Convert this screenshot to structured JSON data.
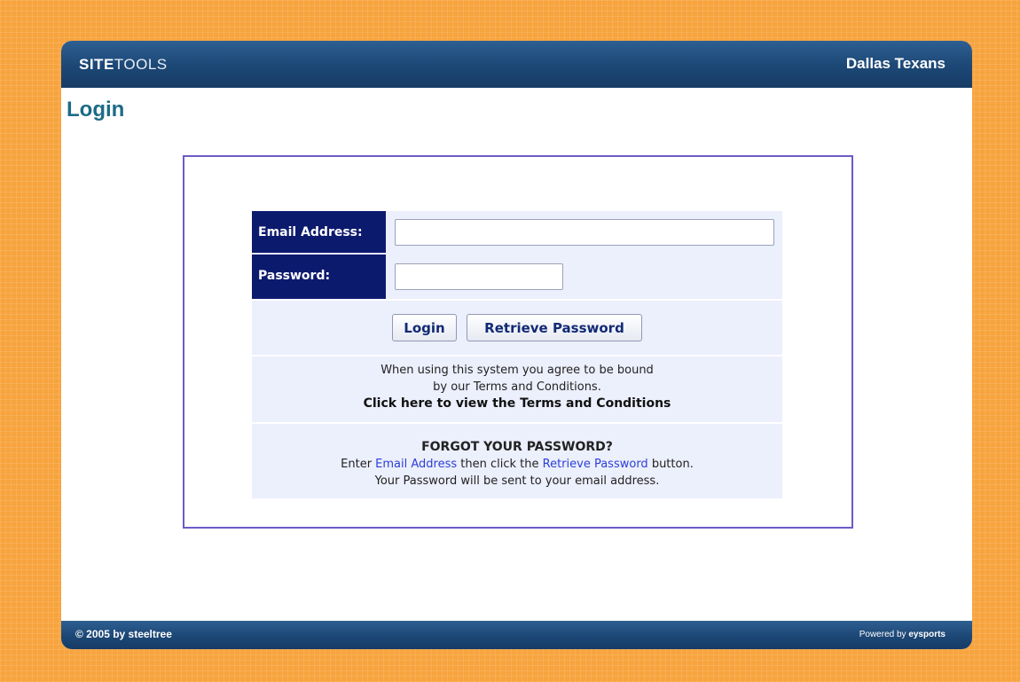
{
  "header": {
    "brand_bold": "SITE",
    "brand_light": "TOOLS",
    "org_name": "Dallas Texans"
  },
  "page": {
    "title": "Login"
  },
  "form": {
    "email_label": "Email Address:",
    "email_value": "",
    "password_label": "Password:",
    "password_value": "",
    "login_button": "Login",
    "retrieve_button": "Retrieve Password"
  },
  "terms": {
    "line1": "When using this system you agree to be bound",
    "line2": "by our Terms and Conditions.",
    "link": "Click here to view the Terms and Conditions"
  },
  "forgot": {
    "heading": "FORGOT YOUR PASSWORD?",
    "pre": "Enter ",
    "email_link": "Email Address",
    "mid": " then click the ",
    "retrieve_link": "Retrieve Password",
    "post": " button.",
    "line3": "Your Password will be sent to your email address."
  },
  "footer": {
    "copyright": "© 2005 by steeltree",
    "powered_prefix": "Powered by ",
    "powered_brand": "eysports"
  },
  "colors": {
    "background_orange": "#f7a43e",
    "header_blue": "#1c4775",
    "label_navy": "#0c1a6e",
    "title_teal": "#1c6b86",
    "box_border_purple": "#6b5cc9",
    "link_blue": "#2b3fd6"
  }
}
